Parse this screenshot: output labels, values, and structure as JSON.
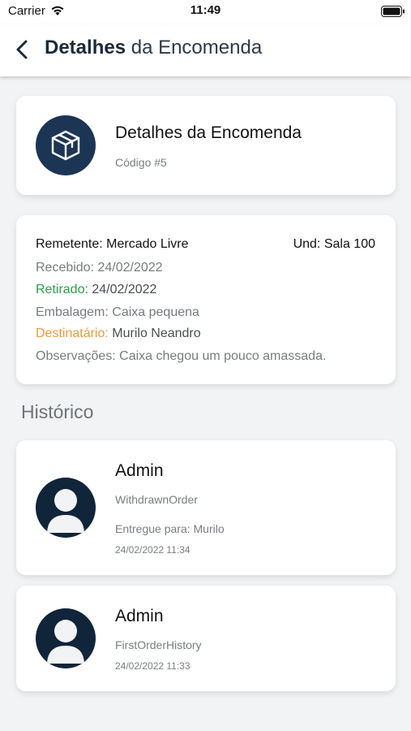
{
  "status_bar": {
    "carrier": "Carrier",
    "time": "11:49"
  },
  "nav": {
    "title_bold": "Detalhes",
    "title_rest": " da Encomenda"
  },
  "header_card": {
    "icon": "package-box-icon",
    "title": "Detalhes da Encomenda",
    "code": "Código #5"
  },
  "details": {
    "sender_label": "Remetente: ",
    "sender": "Mercado Livre",
    "unit_label": "Und: ",
    "unit": "Sala 100",
    "received_label": "Recebido: ",
    "received": "24/02/2022",
    "withdrawn_label": "Retirado:",
    "withdrawn": " 24/02/2022",
    "packaging_label": "Embalagem: ",
    "packaging": "Caixa pequena",
    "recipient_label": "Destinatário:",
    "recipient": " Murilo Neandro",
    "notes_label": "Observações: ",
    "notes": "Caixa chegou um pouco amassada."
  },
  "history": {
    "title": "Histórico",
    "entries": [
      {
        "user": "Admin",
        "type": "WithdrawnOrder",
        "note": "Entregue para: Murilo",
        "date": "24/02/2022 11:34"
      },
      {
        "user": "Admin",
        "type": "FirstOrderHistory",
        "date": "24/02/2022 11:33"
      }
    ]
  },
  "colors": {
    "primary": "#1c3554",
    "avatar_bg": "#10243a",
    "withdrawn": "#2f9a4e",
    "recipient": "#eb9a40",
    "background": "#f2f3f5"
  }
}
